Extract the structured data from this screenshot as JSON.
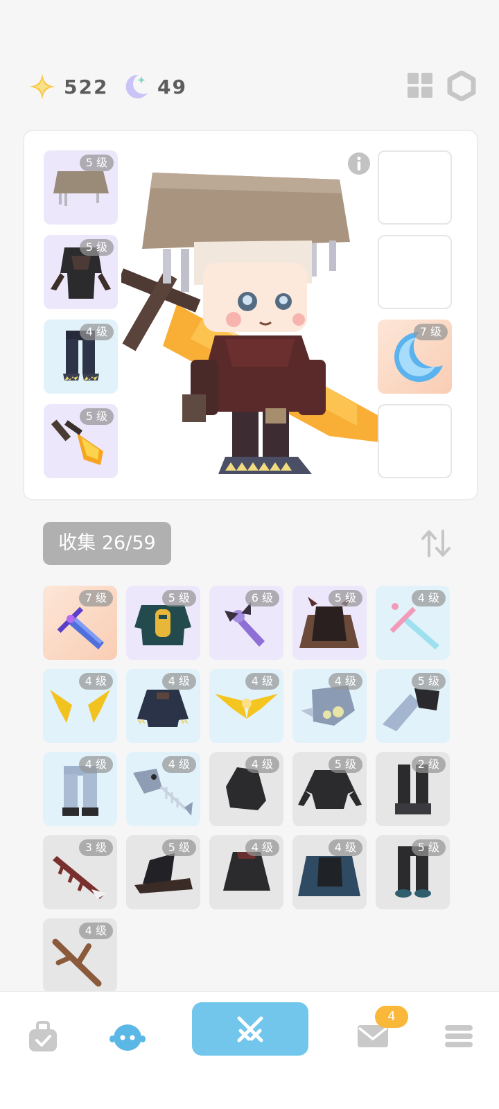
{
  "currencies": {
    "star": {
      "value": "522",
      "icon": "sparkle-star-icon",
      "color": "#f7c948"
    },
    "moon": {
      "value": "49",
      "icon": "crescent-moon-icon",
      "color": "#c9c3f6"
    }
  },
  "header_icons": [
    "grid-icon",
    "hexagon-icon"
  ],
  "equipment": {
    "left": [
      {
        "level": "5 级",
        "item": "straw-hat",
        "bg": "purple"
      },
      {
        "level": "5 级",
        "item": "dark-coat",
        "bg": "purple"
      },
      {
        "level": "4 级",
        "item": "clawed-pants",
        "bg": "blue"
      },
      {
        "level": "5 级",
        "item": "fire-sword",
        "bg": "purple"
      }
    ],
    "right": [
      {
        "level": "",
        "item": "empty",
        "bg": "empty"
      },
      {
        "level": "",
        "item": "empty",
        "bg": "empty"
      },
      {
        "level": "7 级",
        "item": "crescent-moon",
        "bg": "orange"
      },
      {
        "level": "",
        "item": "empty",
        "bg": "empty"
      }
    ]
  },
  "collection": {
    "label": "收集 26/59"
  },
  "items": [
    {
      "level": "7 级",
      "item": "blue-sword",
      "bg": "orange"
    },
    {
      "level": "5 级",
      "item": "green-robe",
      "bg": "purple"
    },
    {
      "level": "6 级",
      "item": "bat-staff",
      "bg": "purple"
    },
    {
      "level": "5 级",
      "item": "horned-cape",
      "bg": "purple"
    },
    {
      "level": "4 级",
      "item": "pink-sword",
      "bg": "blue"
    },
    {
      "level": "4 级",
      "item": "golden-horns",
      "bg": "blue"
    },
    {
      "level": "4 级",
      "item": "navy-jacket",
      "bg": "blue"
    },
    {
      "level": "4 级",
      "item": "golden-wings",
      "bg": "blue"
    },
    {
      "level": "4 级",
      "item": "fish-helmet",
      "bg": "blue"
    },
    {
      "level": "5 级",
      "item": "fish-gauntlet",
      "bg": "blue"
    },
    {
      "level": "4 级",
      "item": "grey-pants",
      "bg": "blue"
    },
    {
      "level": "4 级",
      "item": "fish-skeleton",
      "bg": "blue"
    },
    {
      "level": "4 级",
      "item": "black-hood",
      "bg": "grey"
    },
    {
      "level": "5 级",
      "item": "black-armor",
      "bg": "grey"
    },
    {
      "level": "2 级",
      "item": "black-boots",
      "bg": "grey"
    },
    {
      "level": "3 级",
      "item": "bone-spear",
      "bg": "grey"
    },
    {
      "level": "5 级",
      "item": "witch-hat",
      "bg": "grey"
    },
    {
      "level": "4 级",
      "item": "dark-hood",
      "bg": "grey"
    },
    {
      "level": "4 级",
      "item": "blue-cloak",
      "bg": "grey"
    },
    {
      "level": "5 级",
      "item": "dark-leggings",
      "bg": "grey"
    },
    {
      "level": "4 级",
      "item": "wooden-branch",
      "bg": "grey"
    }
  ],
  "nav": {
    "items": [
      "bag-icon",
      "character-icon",
      "battle-icon",
      "mail-icon",
      "menu-icon"
    ],
    "mail_badge": "4",
    "active_color": "#5bb8e6",
    "battle_color": "#72c6ec"
  }
}
